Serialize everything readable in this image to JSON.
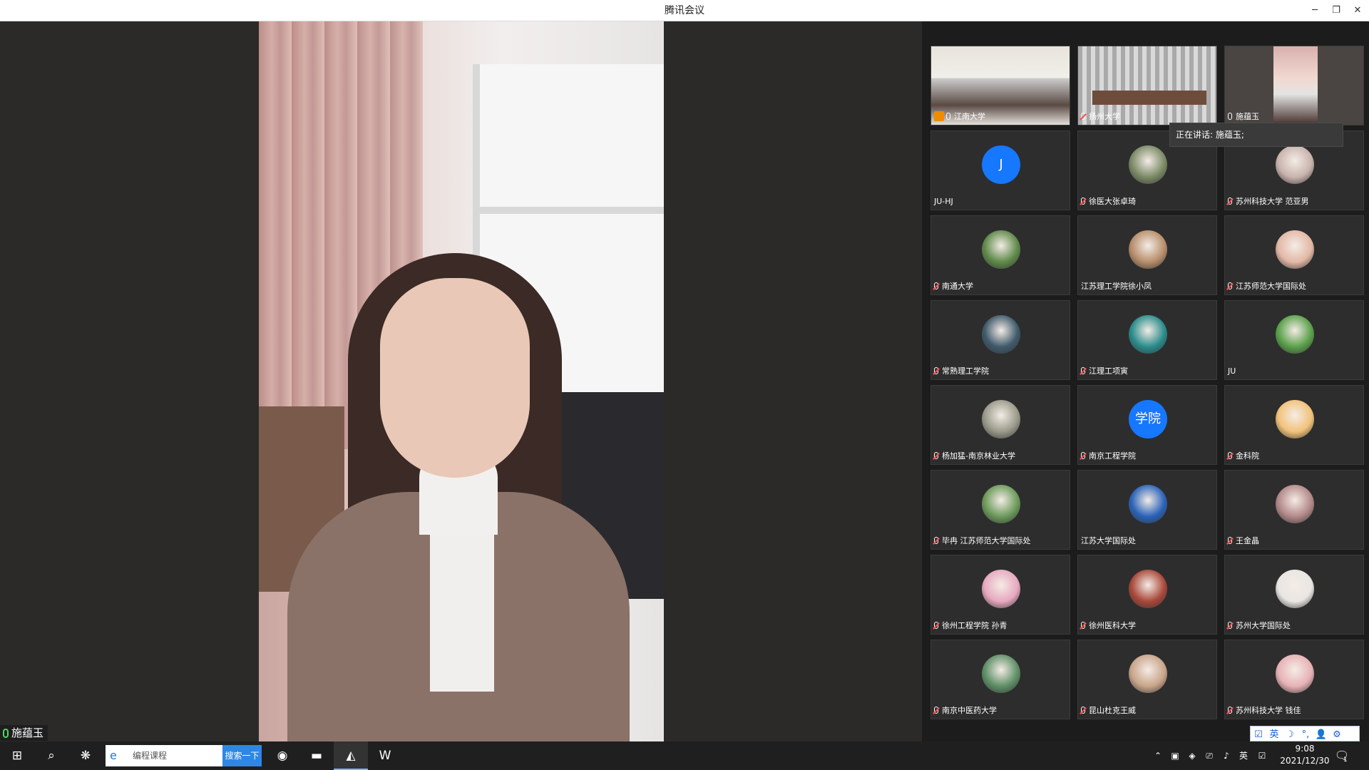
{
  "window": {
    "title": "腾讯会议"
  },
  "main": {
    "speaker_name": "施蕴玉"
  },
  "speaking_tip": "正在讲话: 施蕴玉;",
  "participants": [
    {
      "name": "江南大学",
      "type": "video",
      "scene": "meeting-room",
      "host": true,
      "mic": "on"
    },
    {
      "name": "扬州大学",
      "type": "video",
      "scene": "office",
      "mic": "muted"
    },
    {
      "name": "施蕴玉",
      "type": "video",
      "scene": "speaker",
      "mic": "on"
    },
    {
      "name": "JU-HJ",
      "type": "letter",
      "avatar_text": "J",
      "mic": "none"
    },
    {
      "name": "徐医大张卓琦",
      "type": "photo",
      "color": "#7b8a66",
      "mic": "muted"
    },
    {
      "name": "苏州科技大学 范亚男",
      "type": "photo",
      "color": "#c9b3ad",
      "mic": "muted"
    },
    {
      "name": "南通大学",
      "type": "photo",
      "color": "#5f8a4a",
      "mic": "muted"
    },
    {
      "name": "江苏理工学院徐小凤",
      "type": "photo",
      "color": "#b88e6b",
      "mic": "none"
    },
    {
      "name": "江苏师范大学国际处",
      "type": "photo",
      "color": "#e3b8a6",
      "mic": "muted"
    },
    {
      "name": "常熟理工学院",
      "type": "photo",
      "color": "#3f5a6b",
      "mic": "muted"
    },
    {
      "name": "江理工项寅",
      "type": "photo",
      "color": "#2a8c8c",
      "mic": "muted"
    },
    {
      "name": "JU",
      "type": "photo",
      "color": "#5aa04a",
      "mic": "none"
    },
    {
      "name": "杨加猛-南京林业大学",
      "type": "photo",
      "color": "#9a9a8a",
      "mic": "muted"
    },
    {
      "name": "南京工程学院",
      "type": "letter",
      "avatar_text": "学院",
      "mic": "muted"
    },
    {
      "name": "金科院",
      "type": "photo",
      "color": "#f2c27a",
      "mic": "muted"
    },
    {
      "name": "毕冉 江苏师范大学国际处",
      "type": "photo",
      "color": "#6c9a5a",
      "mic": "muted"
    },
    {
      "name": "江苏大学国际处",
      "type": "photo",
      "color": "#2a63b8",
      "mic": "none"
    },
    {
      "name": "王金晶",
      "type": "photo",
      "color": "#b3898a",
      "mic": "muted"
    },
    {
      "name": "徐州工程学院 孙青",
      "type": "photo",
      "color": "#e7a9c0",
      "mic": "muted"
    },
    {
      "name": "徐州医科大学",
      "type": "photo",
      "color": "#a9483a",
      "mic": "muted"
    },
    {
      "name": "苏州大学国际处",
      "type": "photo",
      "color": "#e9e6e3",
      "mic": "muted"
    },
    {
      "name": "南京中医药大学",
      "type": "photo",
      "color": "#5e8f66",
      "mic": "muted"
    },
    {
      "name": "昆山杜克王威",
      "type": "photo",
      "color": "#c9a58a",
      "mic": "muted"
    },
    {
      "name": "苏州科技大学 钱佳",
      "type": "photo",
      "color": "#e7b2b6",
      "mic": "muted"
    }
  ],
  "ime": {
    "items": [
      "☑",
      "英",
      "☽",
      "°,",
      "👤",
      "⚙"
    ]
  },
  "taskbar": {
    "search_text": "编程课程",
    "search_button": "搜索一下",
    "ime_indicator": "英",
    "time": "9:08",
    "date": "2021/12/30",
    "notification_count": "1"
  }
}
